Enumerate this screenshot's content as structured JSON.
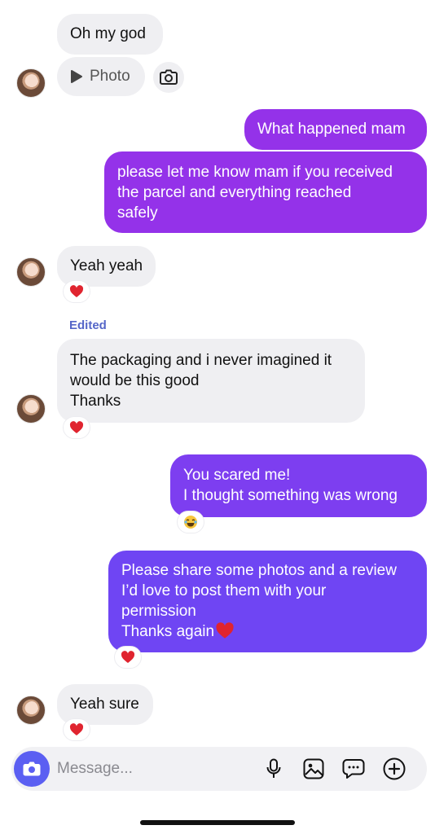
{
  "thread": {
    "msg1": "Oh my god",
    "photo_label": "Photo",
    "msg2": "What happened mam",
    "msg3_lines": [
      "please let me know mam if you received",
      "the parcel and everything reached",
      "safely"
    ],
    "msg4": "Yeah yeah",
    "edited_label": "Edited",
    "msg5_lines": [
      "The packaging and i never imagined it",
      "would be this good",
      "Thanks"
    ],
    "msg6_lines": [
      "You scared me!",
      "I thought something was wrong"
    ],
    "msg7_lines": [
      "Please share some photos and a review",
      "I’d love to post them with your",
      "permission",
      "Thanks again"
    ],
    "msg8": "Yeah sure"
  },
  "reactions": {
    "heart": "heart-reaction",
    "laugh": "laughing-emoji-reaction"
  },
  "composer": {
    "placeholder": "Message..."
  },
  "colors": {
    "incoming_bubble": "#efeff2",
    "outgoing_bubble_top": "#9432e9",
    "outgoing_bubble_mid": "#7d3ef0",
    "outgoing_bubble_bottom": "#6f45f3",
    "accent": "#5b5ff2",
    "edited": "#5566c8",
    "heart": "#e0242f"
  }
}
